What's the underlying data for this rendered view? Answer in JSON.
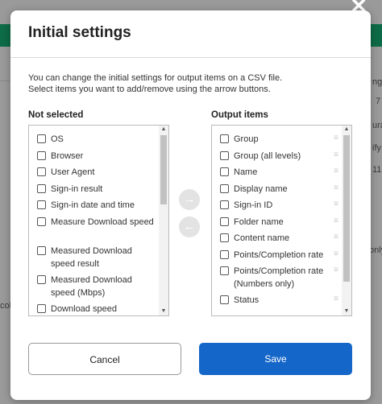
{
  "background": {
    "fragments": [
      "ng",
      "7",
      "ura",
      "ify",
      "11-",
      "only",
      "col"
    ]
  },
  "dialog": {
    "title": "Initial settings",
    "close_glyph": "✕",
    "description_line1": "You can change the initial settings for output items on a CSV file.",
    "description_line2": "Select items you want to add/remove using the arrow buttons.",
    "not_selected_label": "Not selected",
    "output_items_label": "Output items",
    "not_selected_items": [
      "OS",
      "Browser",
      "User Agent",
      "Sign-in result",
      "Sign-in date and time",
      "Measure Download speed",
      "Measured Download speed result",
      "Measured Download speed (Mbps)",
      "Download speed"
    ],
    "output_items": [
      "Group",
      "Group (all levels)",
      "Name",
      "Display name",
      "Sign-in ID",
      "Folder name",
      "Content name",
      "Points/Completion rate",
      "Points/Completion rate (Numbers only)",
      "Status"
    ],
    "add_arrow_glyph": "→",
    "remove_arrow_glyph": "←",
    "drag_handle_glyph": "≡",
    "cancel_label": "Cancel",
    "save_label": "Save",
    "accent_color": "#1466c8"
  }
}
